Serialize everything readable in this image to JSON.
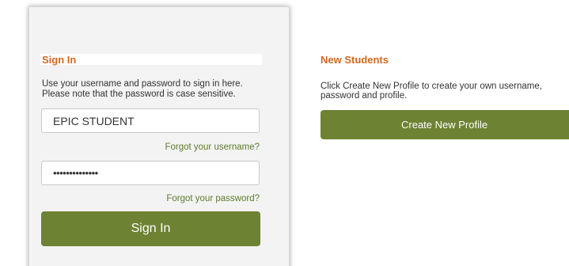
{
  "signin": {
    "heading": "Sign In",
    "instructions_line1": "Use your username and password to sign in here.",
    "instructions_line2": "Please note that the password is case sensitive.",
    "username_value": "EPIC STUDENT",
    "password_value": "••••••••••••••",
    "forgot_username": "Forgot your username?",
    "forgot_password": "Forgot your password?",
    "button_label": "Sign In"
  },
  "new_students": {
    "heading": "New Students",
    "text_line1": "Click Create New Profile to create your own username,",
    "text_line2": "password and profile.",
    "button_label": "Create New Profile"
  },
  "colors": {
    "heading_orange": "#d4691e",
    "button_green": "#6d8233",
    "link_green": "#5f7a2d"
  }
}
